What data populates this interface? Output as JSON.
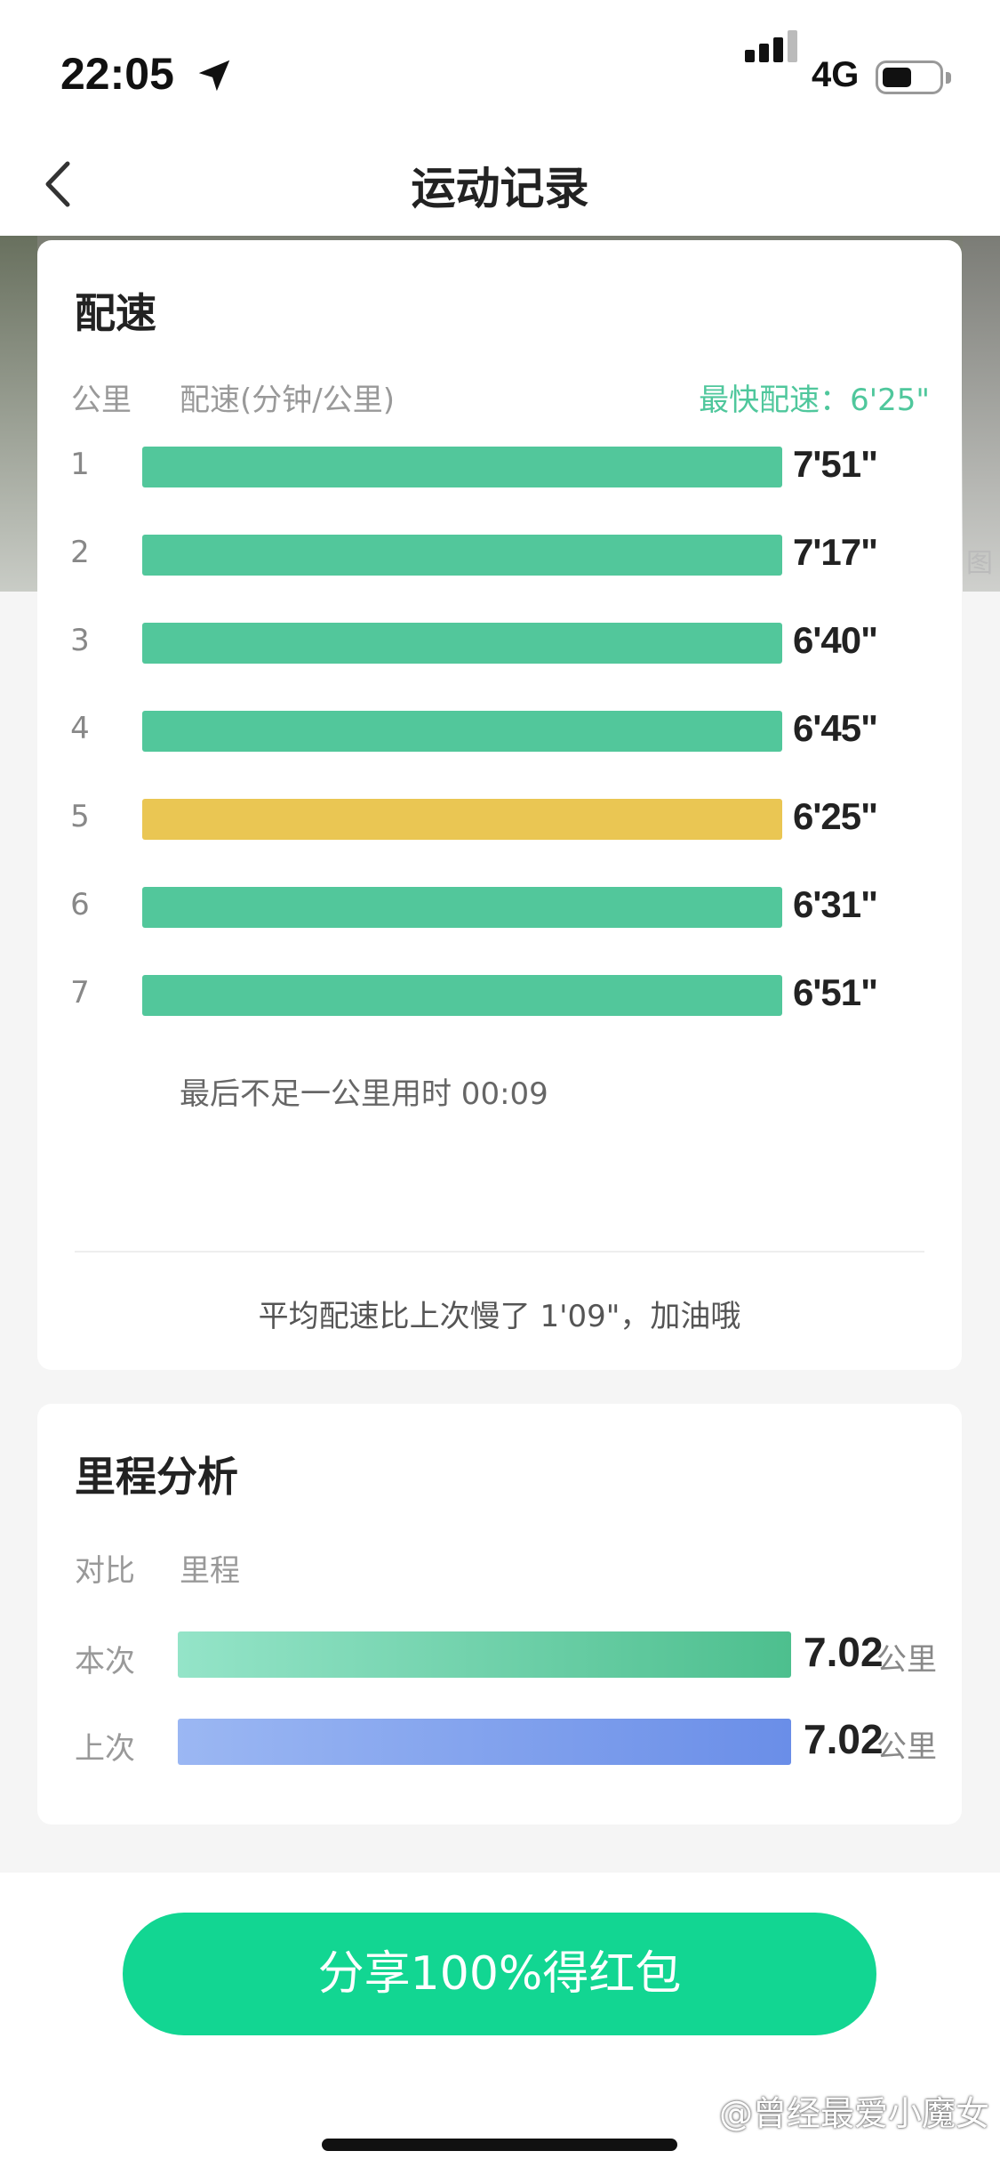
{
  "status_bar": {
    "time": "22:05",
    "network": "4G"
  },
  "nav": {
    "title": "运动记录"
  },
  "pace_card": {
    "title": "配速",
    "col_km": "公里",
    "col_pace": "配速(分钟/公里)",
    "fastest_label": "最快配速：",
    "fastest_value": "6'25\"",
    "rows": [
      {
        "km": "1",
        "pace": "7'51\"",
        "seconds": 471,
        "color": "#52c79b"
      },
      {
        "km": "2",
        "pace": "7'17\"",
        "seconds": 437,
        "color": "#52c79b"
      },
      {
        "km": "3",
        "pace": "6'40\"",
        "seconds": 400,
        "color": "#52c79b"
      },
      {
        "km": "4",
        "pace": "6'45\"",
        "seconds": 405,
        "color": "#52c79b"
      },
      {
        "km": "5",
        "pace": "6'25\"",
        "seconds": 385,
        "color": "#eac653"
      },
      {
        "km": "6",
        "pace": "6'31\"",
        "seconds": 391,
        "color": "#52c79b"
      },
      {
        "km": "7",
        "pace": "6'51\"",
        "seconds": 411,
        "color": "#52c79b"
      }
    ],
    "last_segment": "最后不足一公里用时 00:09",
    "compare": "平均配速比上次慢了 1'09\"，加油哦"
  },
  "mileage_card": {
    "title": "里程分析",
    "col_compare": "对比",
    "col_mileage": "里程",
    "rows": [
      {
        "label": "本次",
        "value": "7.02",
        "unit": "公里",
        "fraction": 1.0,
        "grad_from": "#94e4c8",
        "grad_to": "#4dbf8e"
      },
      {
        "label": "上次",
        "value": "7.02",
        "unit": "公里",
        "fraction": 1.0,
        "grad_from": "#9bb7f3",
        "grad_to": "#6a8ee8"
      }
    ]
  },
  "share_button": {
    "label": "分享100%得红包"
  },
  "watermark": "@曾经最爱小魔女",
  "photo_tag": "图"
}
